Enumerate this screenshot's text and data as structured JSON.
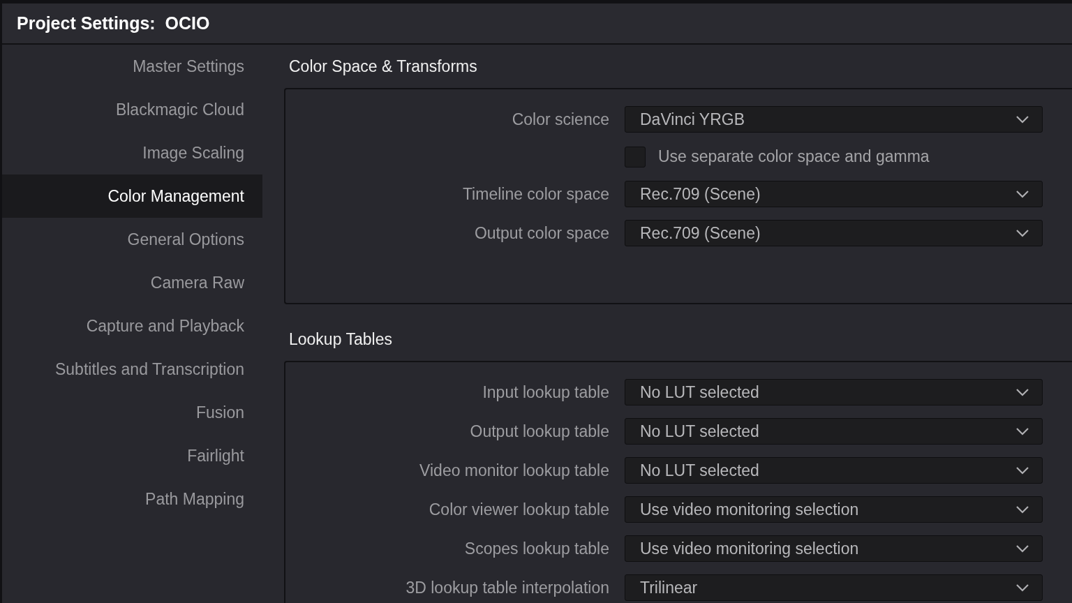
{
  "window": {
    "title": "Project Settings:  OCIO"
  },
  "sidebar": {
    "items": [
      {
        "label": "Master Settings",
        "selected": false
      },
      {
        "label": "Blackmagic Cloud",
        "selected": false
      },
      {
        "label": "Image Scaling",
        "selected": false
      },
      {
        "label": "Color Management",
        "selected": true
      },
      {
        "label": "General Options",
        "selected": false
      },
      {
        "label": "Camera Raw",
        "selected": false
      },
      {
        "label": "Capture and Playback",
        "selected": false
      },
      {
        "label": "Subtitles and Transcription",
        "selected": false
      },
      {
        "label": "Fusion",
        "selected": false
      },
      {
        "label": "Fairlight",
        "selected": false
      },
      {
        "label": "Path Mapping",
        "selected": false
      }
    ]
  },
  "sections": [
    {
      "title": "Color Space & Transforms",
      "rows": [
        {
          "kind": "dropdown",
          "label": "Color science",
          "value": "DaVinci YRGB"
        },
        {
          "kind": "checkbox",
          "label": "Use separate color space and gamma",
          "checked": false
        },
        {
          "kind": "dropdown",
          "label": "Timeline color space",
          "value": "Rec.709 (Scene)"
        },
        {
          "kind": "dropdown",
          "label": "Output color space",
          "value": "Rec.709 (Scene)"
        }
      ]
    },
    {
      "title": "Lookup Tables",
      "rows": [
        {
          "kind": "dropdown",
          "label": "Input lookup table",
          "value": "No LUT selected"
        },
        {
          "kind": "dropdown",
          "label": "Output lookup table",
          "value": "No LUT selected"
        },
        {
          "kind": "dropdown",
          "label": "Video monitor lookup table",
          "value": "No LUT selected"
        },
        {
          "kind": "dropdown",
          "label": "Color viewer lookup table",
          "value": "Use video monitoring selection"
        },
        {
          "kind": "dropdown",
          "label": "Scopes lookup table",
          "value": "Use video monitoring selection"
        },
        {
          "kind": "dropdown",
          "label": "3D lookup table interpolation",
          "value": "Trilinear"
        }
      ]
    }
  ]
}
